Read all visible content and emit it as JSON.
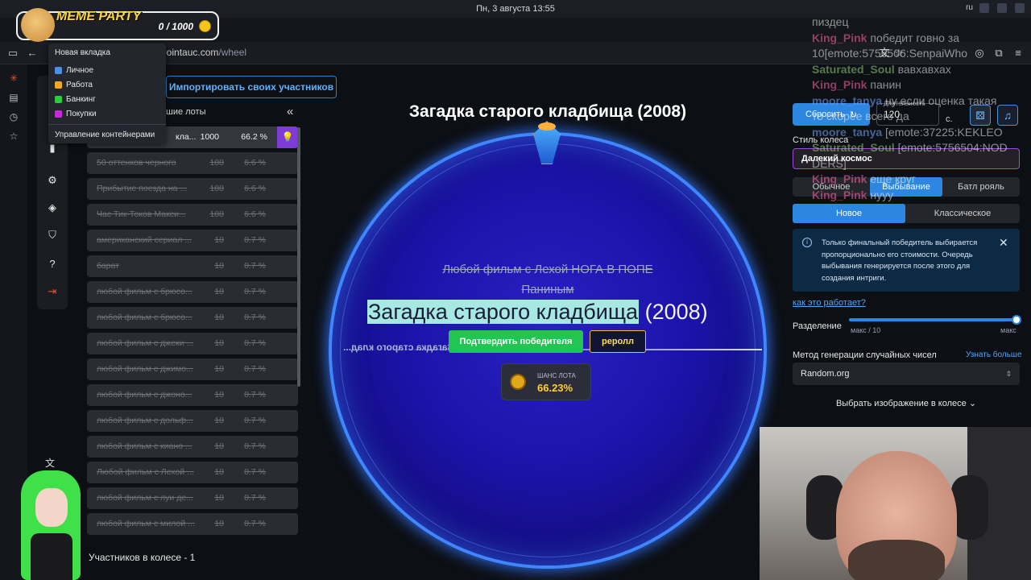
{
  "os": {
    "datetime": "Пн, 3 августа  13:55",
    "lang": "ru"
  },
  "browser": {
    "url_host": "pointauc.com",
    "url_path": "/wheel"
  },
  "meme_party": {
    "title": "MEME PARTY",
    "score": "0 / 1000"
  },
  "container_menu": {
    "header": "Новая вкладка",
    "items": [
      {
        "label": "Личное",
        "color": "#4a90e2"
      },
      {
        "label": "Работа",
        "color": "#f5a623"
      },
      {
        "label": "Банкинг",
        "color": "#2ecc40"
      },
      {
        "label": "Покупки",
        "color": "#c82ad8"
      }
    ],
    "footer": "Управление контейнерами"
  },
  "import_button": "Импортировать своих участников",
  "lots_header": "шие лоты",
  "lots": [
    {
      "name": "кла...",
      "amount": "1000",
      "pct": "66.2 %",
      "active": true
    },
    {
      "name": "50 оттенков черного",
      "amount": "100",
      "pct": "6.6 %"
    },
    {
      "name": "Прибытие поезда на ...",
      "amount": "100",
      "pct": "6.6 %"
    },
    {
      "name": "Час Тик-Токов Макси...",
      "amount": "100",
      "pct": "6.6 %"
    },
    {
      "name": "американский сериал ...",
      "amount": "10",
      "pct": "0.7 %"
    },
    {
      "name": "барат",
      "amount": "10",
      "pct": "0.7 %"
    },
    {
      "name": "любой фильм с брюсо...",
      "amount": "10",
      "pct": "0.7 %"
    },
    {
      "name": "любой фильм с брюсо...",
      "amount": "10",
      "pct": "0.7 %"
    },
    {
      "name": "любой фильм с джеки ...",
      "amount": "10",
      "pct": "0.7 %"
    },
    {
      "name": "любой фильм с джимо...",
      "amount": "10",
      "pct": "0.7 %"
    },
    {
      "name": "любой фильм с джоно...",
      "amount": "10",
      "pct": "0.7 %"
    },
    {
      "name": "любой фильм с дольф...",
      "amount": "10",
      "pct": "0.7 %"
    },
    {
      "name": "любой фильм с киано ...",
      "amount": "10",
      "pct": "0.7 %"
    },
    {
      "name": "Любой фильм с Лехой ...",
      "amount": "10",
      "pct": "0.7 %"
    },
    {
      "name": "любой фильм с луи де...",
      "amount": "10",
      "pct": "0.7 %"
    },
    {
      "name": "любой фильм с милой ...",
      "amount": "10",
      "pct": "0.7 %"
    }
  ],
  "participants": "Участников в колесе - 1",
  "wheel": {
    "title": "Загадка старого кладбища (2008)",
    "prev_winner_line1": "Любой фильм с Лехой НОГА В ПОПЕ",
    "prev_winner_line2": "Паниным",
    "winner_highlight": "Загадка старого кладбища",
    "winner_rest": " (2008)",
    "mirror_text": "Загадка старого клад...",
    "confirm_button": "Подтвердить победителя",
    "reroll_button": "реролл",
    "chance_label": "ШАНС ЛОТА",
    "chance_value": "66.23%"
  },
  "settings": {
    "reset_button": "Сбросить",
    "duration_label": "Длительность",
    "duration_value": "120",
    "seconds_unit": "с.",
    "style_label": "Стиль колеса",
    "style_value": "Далекий космос",
    "mode_options": [
      "Обычное",
      "Выбывание",
      "Батл рояль"
    ],
    "mode_selected": 1,
    "order_options": [
      "Новое",
      "Классическое"
    ],
    "order_selected": 0,
    "info_text": "Только финальный победитель выбирается пропорционально его стоимости. Очередь выбывания генерируется после этого для создания интриги.",
    "how_link": "как это работает?",
    "split_label": "Разделение",
    "split_min": "макс / 10",
    "split_max": "макс",
    "split_level": 1.0,
    "rng_label": "Метод генерации случайных чисел",
    "rng_link": "Узнать больше",
    "rng_value": "Random.org",
    "image_select": "Выбрать изображение в колесе"
  },
  "chat": [
    {
      "text": "пиздец"
    },
    {
      "user": "King_Pink",
      "text": " победит говно за 10[emote:5756506:SenpaiWho",
      "color": "pink"
    },
    {
      "user": "Saturated_Soul",
      "text": " вавхавхах",
      "color": "green"
    },
    {
      "user": "King_Pink",
      "text": " панин",
      "color": "pink"
    },
    {
      "user": "moore_tanya",
      "text": " ну если оценка такая",
      "color": "blue"
    },
    {
      "text": "то скорее всего да"
    },
    {
      "user": "moore_tanya",
      "text": " [emote:37225:KEKLEO",
      "color": "blue"
    },
    {
      "user": "Saturated_Soul",
      "text": " [emote:5756504:NOD DERS]",
      "color": "green"
    },
    {
      "user": "King_Pink",
      "text": " еще круг",
      "color": "pink"
    },
    {
      "user": "King_Pink",
      "text": " нууу",
      "color": "pink"
    }
  ]
}
